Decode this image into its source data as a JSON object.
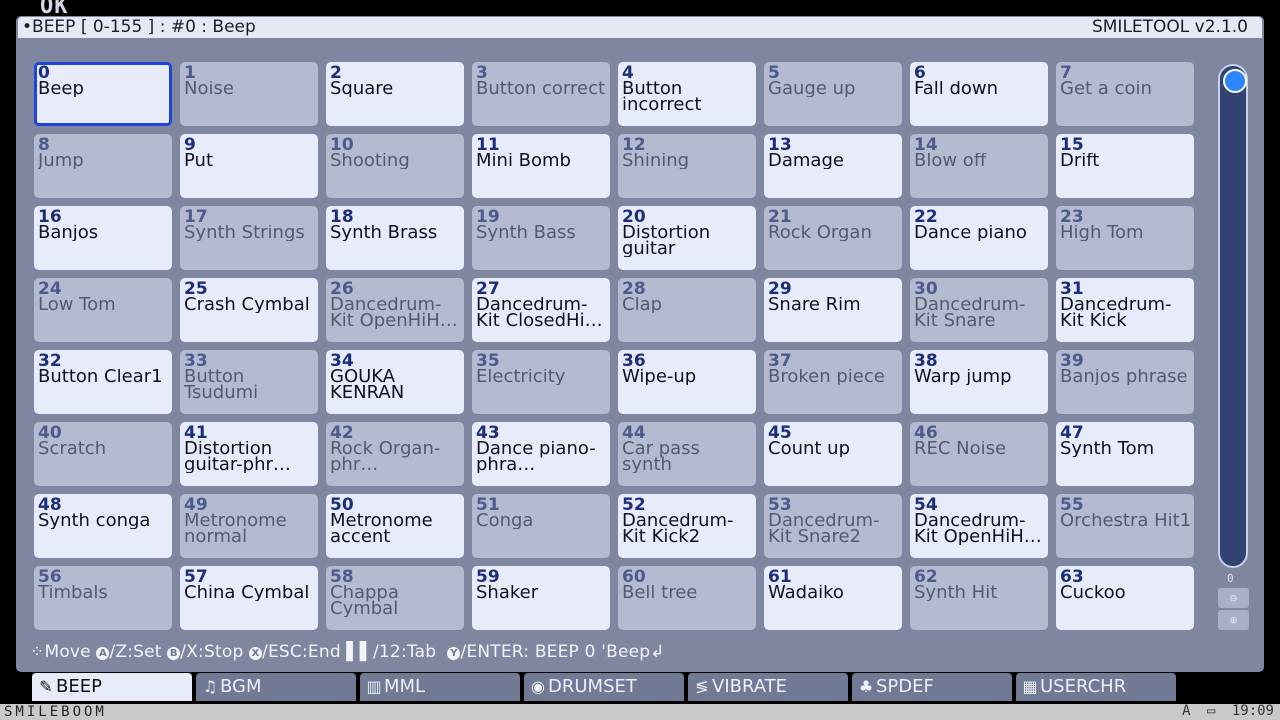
{
  "ghost_text": "OK",
  "title_left": "•BEEP [ 0-155 ] : #0 : Beep",
  "title_right": "SMILETOOL v2.1.0",
  "sounds": [
    {
      "num": "0",
      "name": "Beep",
      "state": "sel"
    },
    {
      "num": "1",
      "name": "Noise",
      "state": "off"
    },
    {
      "num": "2",
      "name": "Square",
      "state": "on"
    },
    {
      "num": "3",
      "name": "Button correct",
      "state": "off"
    },
    {
      "num": "4",
      "name": "Button incorrect",
      "state": "on"
    },
    {
      "num": "5",
      "name": "Gauge up",
      "state": "off"
    },
    {
      "num": "6",
      "name": "Fall down",
      "state": "on"
    },
    {
      "num": "7",
      "name": "Get a coin",
      "state": "off"
    },
    {
      "num": "8",
      "name": "Jump",
      "state": "off"
    },
    {
      "num": "9",
      "name": "Put",
      "state": "on"
    },
    {
      "num": "10",
      "name": "Shooting",
      "state": "off"
    },
    {
      "num": "11",
      "name": "Mini Bomb",
      "state": "on"
    },
    {
      "num": "12",
      "name": "Shining",
      "state": "off"
    },
    {
      "num": "13",
      "name": "Damage",
      "state": "on"
    },
    {
      "num": "14",
      "name": "Blow off",
      "state": "off"
    },
    {
      "num": "15",
      "name": "Drift",
      "state": "on"
    },
    {
      "num": "16",
      "name": "Banjos",
      "state": "on"
    },
    {
      "num": "17",
      "name": "Synth Strings",
      "state": "off"
    },
    {
      "num": "18",
      "name": "Synth Brass",
      "state": "on"
    },
    {
      "num": "19",
      "name": "Synth Bass",
      "state": "off"
    },
    {
      "num": "20",
      "name": "Distortion guitar",
      "state": "on"
    },
    {
      "num": "21",
      "name": "Rock Organ",
      "state": "off"
    },
    {
      "num": "22",
      "name": "Dance piano",
      "state": "on"
    },
    {
      "num": "23",
      "name": "High Tom",
      "state": "off"
    },
    {
      "num": "24",
      "name": "Low Tom",
      "state": "off"
    },
    {
      "num": "25",
      "name": "Crash Cymbal",
      "state": "on"
    },
    {
      "num": "26",
      "name": "Dancedrum-Kit OpenHiH…",
      "state": "off"
    },
    {
      "num": "27",
      "name": "Dancedrum-Kit ClosedHi…",
      "state": "on"
    },
    {
      "num": "28",
      "name": "Clap",
      "state": "off"
    },
    {
      "num": "29",
      "name": "Snare Rim",
      "state": "on"
    },
    {
      "num": "30",
      "name": "Dancedrum-Kit Snare",
      "state": "off"
    },
    {
      "num": "31",
      "name": "Dancedrum-Kit Kick",
      "state": "on"
    },
    {
      "num": "32",
      "name": "Button Clear1",
      "state": "on"
    },
    {
      "num": "33",
      "name": "Button Tsudumi",
      "state": "off"
    },
    {
      "num": "34",
      "name": "GOUKA KENRAN",
      "state": "on"
    },
    {
      "num": "35",
      "name": "Electricity",
      "state": "off"
    },
    {
      "num": "36",
      "name": "Wipe-up",
      "state": "on"
    },
    {
      "num": "37",
      "name": "Broken piece",
      "state": "off"
    },
    {
      "num": "38",
      "name": "Warp jump",
      "state": "on"
    },
    {
      "num": "39",
      "name": "Banjos phrase",
      "state": "off"
    },
    {
      "num": "40",
      "name": "Scratch",
      "state": "off"
    },
    {
      "num": "41",
      "name": "Distortion guitar-phr…",
      "state": "on"
    },
    {
      "num": "42",
      "name": "Rock Organ-phr…",
      "state": "off"
    },
    {
      "num": "43",
      "name": "Dance piano-phra…",
      "state": "on"
    },
    {
      "num": "44",
      "name": "Car pass synth",
      "state": "off"
    },
    {
      "num": "45",
      "name": "Count up",
      "state": "on"
    },
    {
      "num": "46",
      "name": "REC Noise",
      "state": "off"
    },
    {
      "num": "47",
      "name": "Synth Tom",
      "state": "on"
    },
    {
      "num": "48",
      "name": "Synth conga",
      "state": "on"
    },
    {
      "num": "49",
      "name": "Metronome normal",
      "state": "off"
    },
    {
      "num": "50",
      "name": "Metronome accent",
      "state": "on"
    },
    {
      "num": "51",
      "name": "Conga",
      "state": "off"
    },
    {
      "num": "52",
      "name": "Dancedrum-Kit Kick2",
      "state": "on"
    },
    {
      "num": "53",
      "name": "Dancedrum-Kit Snare2",
      "state": "off"
    },
    {
      "num": "54",
      "name": "Dancedrum-Kit OpenHiH…",
      "state": "on"
    },
    {
      "num": "55",
      "name": "Orchestra Hit1",
      "state": "off"
    },
    {
      "num": "56",
      "name": "Timbals",
      "state": "off"
    },
    {
      "num": "57",
      "name": "China Cymbal",
      "state": "on"
    },
    {
      "num": "58",
      "name": "Chappa Cymbal",
      "state": "off"
    },
    {
      "num": "59",
      "name": "Shaker",
      "state": "on"
    },
    {
      "num": "60",
      "name": "Bell tree",
      "state": "off"
    },
    {
      "num": "61",
      "name": "Wadaiko",
      "state": "on"
    },
    {
      "num": "62",
      "name": "Synth Hit",
      "state": "off"
    },
    {
      "num": "63",
      "name": "Cuckoo",
      "state": "on"
    }
  ],
  "scroll_label": "0",
  "zoom_minus": "⊖",
  "zoom_plus": "⊕",
  "hint": {
    "move": "Move",
    "set": "/Z:Set",
    "stop": "/X:Stop",
    "end": "/ESC:End",
    "tab": "/12:Tab",
    "enter": "/ENTER: BEEP 0 'Beep↲"
  },
  "tabs": [
    {
      "icon": "✎",
      "label": "BEEP",
      "active": true
    },
    {
      "icon": "♫",
      "label": "BGM",
      "active": false
    },
    {
      "icon": "▥",
      "label": "MML",
      "active": false
    },
    {
      "icon": "◉",
      "label": "DRUMSET",
      "active": false
    },
    {
      "icon": "≶",
      "label": "VIBRATE",
      "active": false
    },
    {
      "icon": "♣",
      "label": "SPDEF",
      "active": false
    },
    {
      "icon": "▦",
      "label": "USERCHR",
      "active": false
    }
  ],
  "brand": "SMILEBOOM",
  "status": {
    "ime": "A",
    "battery": "▭",
    "time": "19:09"
  },
  "colors": {
    "selected_border": "#1f44d8",
    "panel": "#7e879f",
    "active_cell": "#e8ecfa",
    "inactive_cell": "#b4bbd0"
  }
}
